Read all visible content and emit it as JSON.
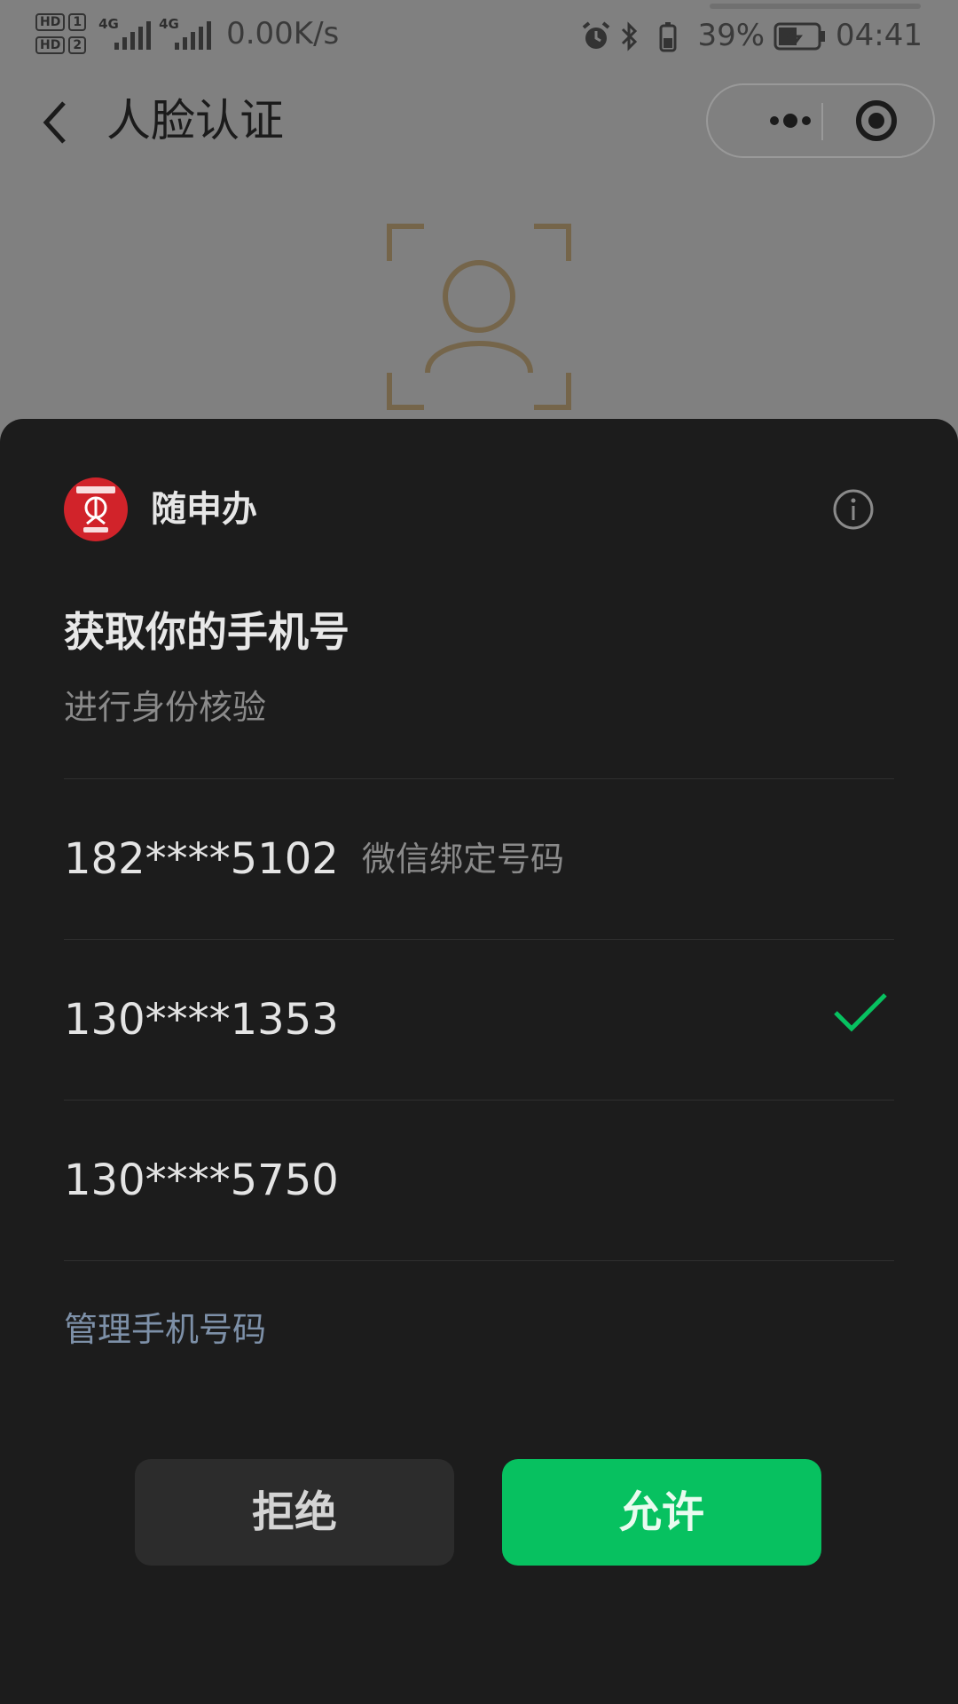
{
  "status_bar": {
    "sim1": "HD",
    "sim1_num": "1",
    "sim2": "HD",
    "sim2_num": "2",
    "net1": "4G",
    "net2": "4G",
    "speed": "0.00K/s",
    "battery": "39%",
    "time": "04:41"
  },
  "nav": {
    "title": "人脸认证"
  },
  "sheet": {
    "app_name": "随申办",
    "request_title": "获取你的手机号",
    "request_subtitle": "进行身份核验",
    "phones": [
      {
        "number": "182****5102",
        "tag": "微信绑定号码",
        "selected": false
      },
      {
        "number": "130****1353",
        "tag": "",
        "selected": true
      },
      {
        "number": "130****5750",
        "tag": "",
        "selected": false
      }
    ],
    "manage_link": "管理手机号码",
    "deny_label": "拒绝",
    "allow_label": "允许"
  },
  "colors": {
    "accent_green": "#07c160",
    "link_blue": "#7d90a8",
    "face_frame": "#75654a",
    "logo_red": "#d1232a"
  }
}
